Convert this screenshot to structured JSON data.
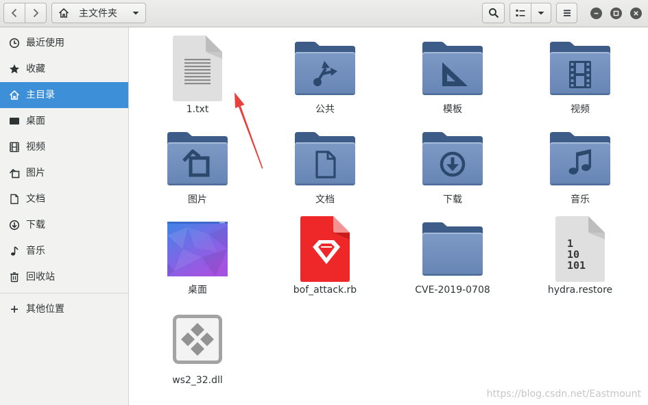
{
  "header": {
    "back_icon": "chevron-left-icon",
    "forward_icon": "chevron-right-icon",
    "location_icon": "home-icon",
    "location_label": "主文件夹",
    "location_dropdown_icon": "dropdown-arrow-icon",
    "search_icon": "search-icon",
    "view_icon": "list-view-icon",
    "view_dropdown_icon": "dropdown-arrow-icon",
    "menu_icon": "hamburger-menu-icon",
    "window_controls": [
      "minimize-icon",
      "maximize-icon",
      "close-icon"
    ]
  },
  "sidebar": {
    "items": [
      {
        "label": "最近使用",
        "icon": "clock-icon"
      },
      {
        "label": "收藏",
        "icon": "star-icon"
      },
      {
        "label": "主目录",
        "icon": "home-icon",
        "selected": true
      },
      {
        "label": "桌面",
        "icon": "desktop-icon"
      },
      {
        "label": "视频",
        "icon": "video-icon"
      },
      {
        "label": "图片",
        "icon": "picture-icon"
      },
      {
        "label": "文档",
        "icon": "document-icon"
      },
      {
        "label": "下载",
        "icon": "download-icon"
      },
      {
        "label": "音乐",
        "icon": "music-icon"
      },
      {
        "label": "回收站",
        "icon": "trash-icon"
      }
    ],
    "other_locations": {
      "label": "其他位置",
      "icon": "plus-icon"
    }
  },
  "files": [
    {
      "name": "1.txt",
      "icon": "text-file-icon"
    },
    {
      "name": "公共",
      "icon": "folder-public-icon"
    },
    {
      "name": "模板",
      "icon": "folder-templates-icon"
    },
    {
      "name": "视频",
      "icon": "folder-videos-icon"
    },
    {
      "name": "图片",
      "icon": "folder-pictures-icon"
    },
    {
      "name": "文档",
      "icon": "folder-documents-icon"
    },
    {
      "name": "下载",
      "icon": "folder-download-icon"
    },
    {
      "name": "音乐",
      "icon": "folder-music-icon"
    },
    {
      "name": "桌面",
      "icon": "desktop-thumbnail-icon"
    },
    {
      "name": "bof_attack.rb",
      "icon": "ruby-file-icon"
    },
    {
      "name": "CVE-2019-0708",
      "icon": "folder-icon"
    },
    {
      "name": "hydra.restore",
      "icon": "binary-file-icon",
      "icon_text": [
        "1",
        "10",
        "101"
      ]
    },
    {
      "name": "ws2_32.dll",
      "icon": "dll-file-icon"
    }
  ],
  "annotation_arrow": {
    "icon": "red-arrow-icon",
    "color": "#e8403a"
  },
  "watermark": "https://blog.csdn.net/Eastmount",
  "colors": {
    "accent": "#3d8fd8",
    "folder": "#7290bd",
    "folder_dark": "#3d5c88",
    "text": "#2e3436",
    "ruby": "#ee2828"
  }
}
